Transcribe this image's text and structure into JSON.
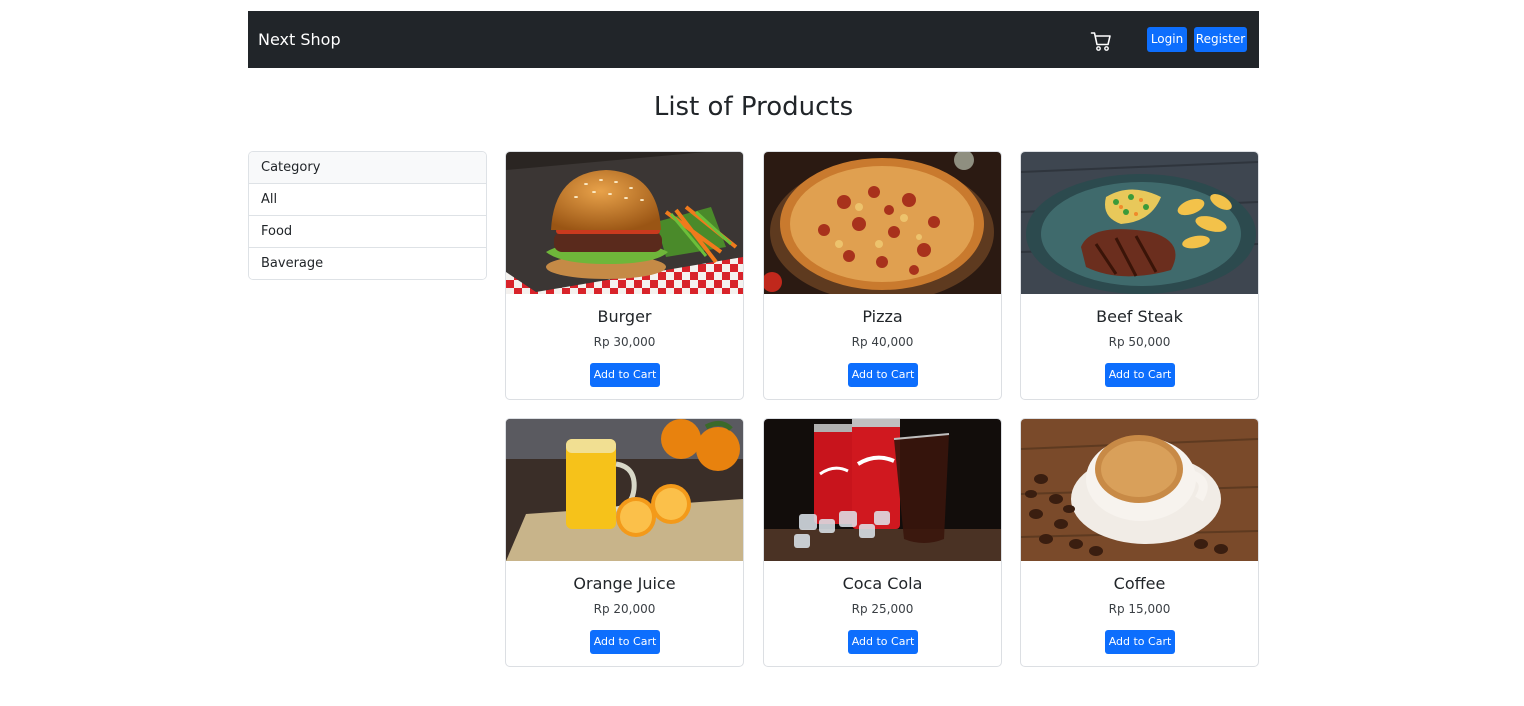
{
  "navbar": {
    "brand": "Next Shop",
    "cart_icon": "shopping-cart-icon",
    "login_label": "Login",
    "register_label": "Register",
    "background": "#212529",
    "accent": "#0d6efd"
  },
  "page": {
    "title": "List of Products"
  },
  "categories": {
    "header": "Category",
    "items": [
      "All",
      "Food",
      "Baverage"
    ]
  },
  "products": [
    {
      "name": "Burger",
      "price": "Rp 30,000",
      "button": "Add to Cart",
      "image": "burger-image"
    },
    {
      "name": "Pizza",
      "price": "Rp 40,000",
      "button": "Add to Cart",
      "image": "pizza-image"
    },
    {
      "name": "Beef Steak",
      "price": "Rp 50,000",
      "button": "Add to Cart",
      "image": "beef-steak-image"
    },
    {
      "name": "Orange Juice",
      "price": "Rp 20,000",
      "button": "Add to Cart",
      "image": "orange-juice-image"
    },
    {
      "name": "Coca Cola",
      "price": "Rp 25,000",
      "button": "Add to Cart",
      "image": "coca-cola-image"
    },
    {
      "name": "Coffee",
      "price": "Rp 15,000",
      "button": "Add to Cart",
      "image": "coffee-image"
    }
  ]
}
